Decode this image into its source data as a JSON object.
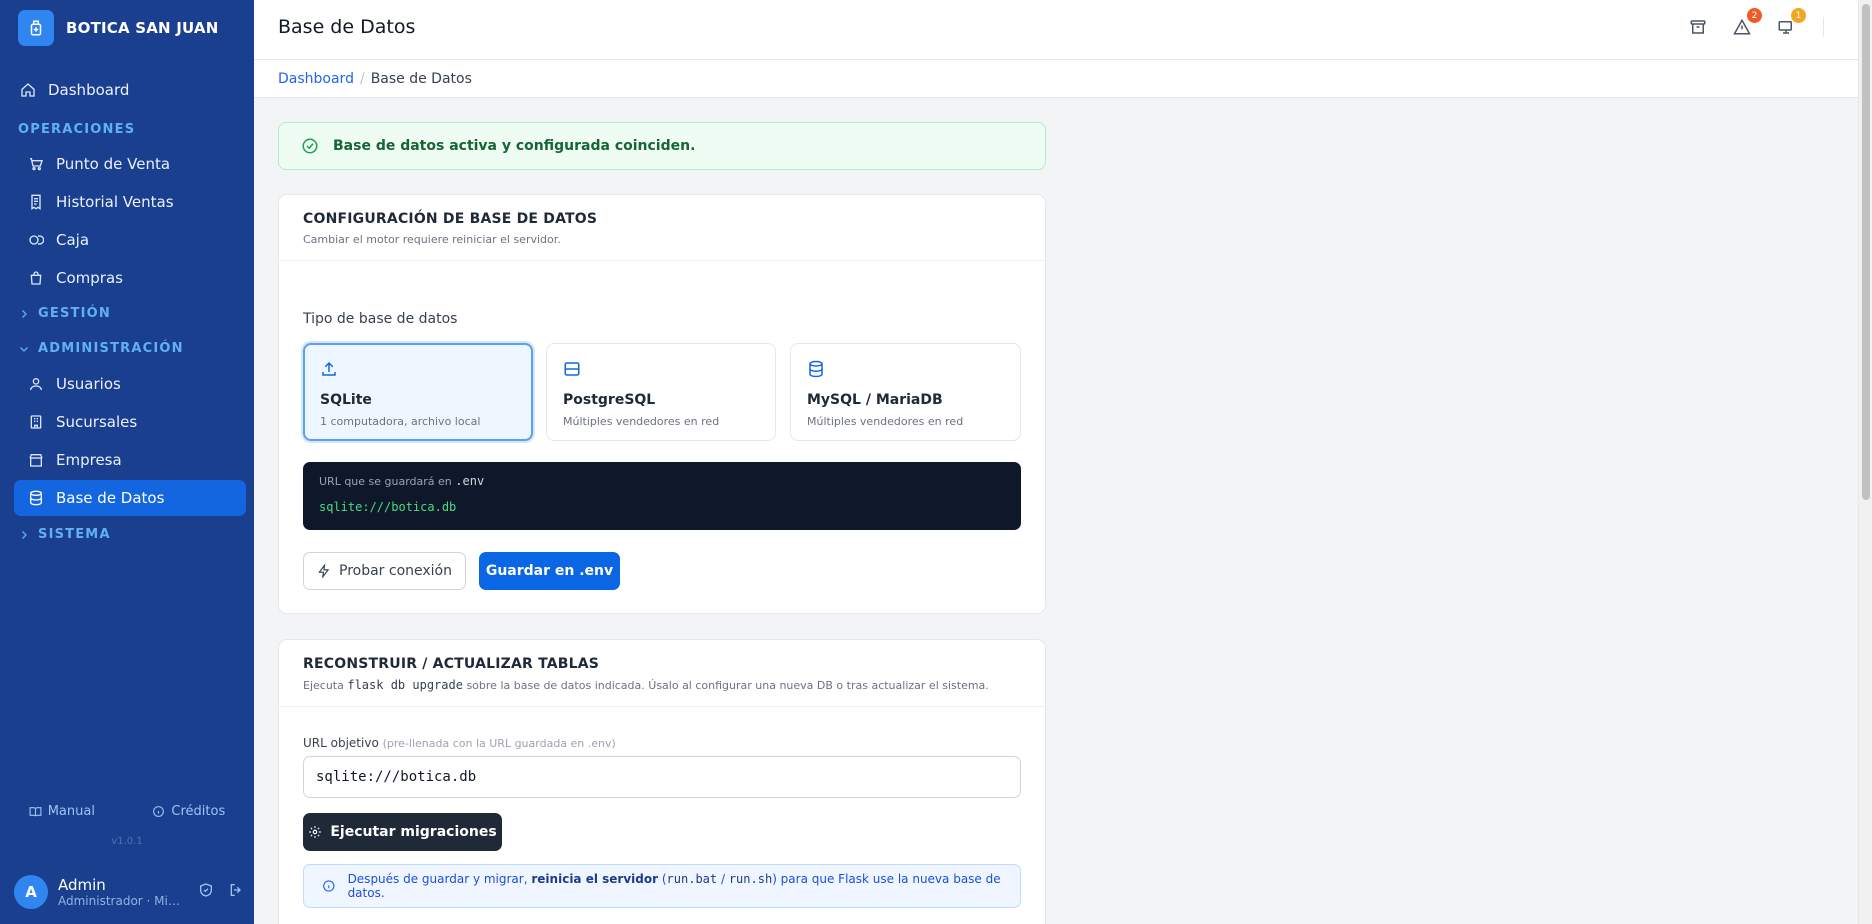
{
  "app": {
    "brand": "BOTICA SAN JUAN",
    "version": "v1.0.1"
  },
  "colors": {
    "sidebar": "#1b3f8f",
    "accent": "#0a66e4",
    "success": "#166534",
    "badge_alerts": "#f05a24",
    "badge_messages": "#f5a524"
  },
  "sidebar": {
    "dashboard": "Dashboard",
    "sections": {
      "operaciones": "OPERACIONES",
      "gestion": "GESTIÓN",
      "administracion": "ADMINISTRACIÓN",
      "sistema": "SISTEMA"
    },
    "operaciones_items": [
      "Punto de Venta",
      "Historial Ventas",
      "Caja",
      "Compras"
    ],
    "admin_items": [
      "Usuarios",
      "Sucursales",
      "Empresa",
      "Base de Datos"
    ],
    "footer": {
      "manual": "Manual",
      "creditos": "Créditos"
    },
    "user": {
      "initial": "A",
      "name": "Admin",
      "role": "Administrador · Mi …"
    }
  },
  "header": {
    "title": "Base de Datos",
    "alerts_count": "2",
    "messages_count": "1"
  },
  "breadcrumb": {
    "parent": "Dashboard",
    "sep": "/",
    "current": "Base de Datos"
  },
  "status_alert": "Base de datos activa y configurada coinciden.",
  "config": {
    "title": "CONFIGURACIÓN DE BASE DE DATOS",
    "subtitle": "Cambiar el motor requiere reiniciar el servidor.",
    "type_label": "Tipo de base de datos",
    "options": [
      {
        "name": "SQLite",
        "desc": "1 computadora, archivo local",
        "icon": "upload-icon"
      },
      {
        "name": "PostgreSQL",
        "desc": "Múltiples vendedores en red",
        "icon": "server-icon"
      },
      {
        "name": "MySQL / MariaDB",
        "desc": "Múltiples vendedores en red",
        "icon": "database-icon"
      }
    ],
    "url_label": "URL que se guardará en",
    "url_file": ".env",
    "url_value": "sqlite:///botica.db",
    "test_button": "Probar conexión",
    "save_button": "Guardar en .env"
  },
  "rebuild": {
    "title": "RECONSTRUIR / ACTUALIZAR TABLAS",
    "sub_prefix": "Ejecuta",
    "sub_code": "flask db upgrade",
    "sub_suffix": "sobre la base de datos indicada. Úsalo al configurar una nueva DB o tras actualizar el sistema.",
    "url_label": "URL objetivo",
    "url_hint": "(pre-llenada con la URL guardada en .env)",
    "url_value": "sqlite:///botica.db",
    "run_button": "Ejecutar migraciones",
    "info_prefix": "Después de guardar y migrar,",
    "info_bold": "reinicia el servidor",
    "info_open": "(",
    "info_code1": "run.bat",
    "info_slash": "/",
    "info_code2": "run.sh",
    "info_suffix": ") para que Flask use la nueva base de datos."
  }
}
